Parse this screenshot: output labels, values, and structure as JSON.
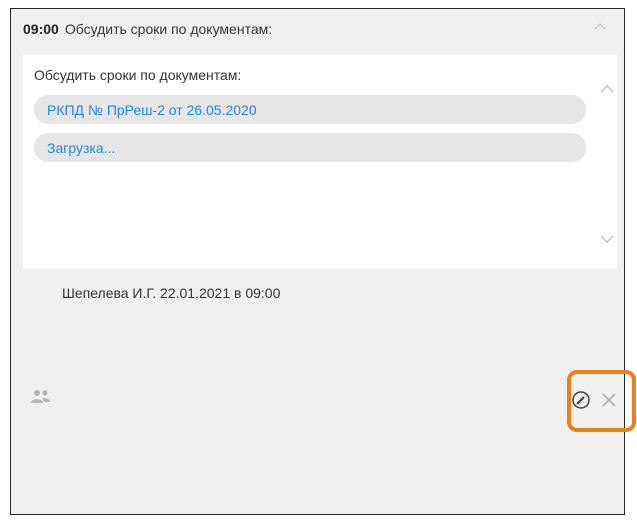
{
  "event": {
    "time": "09:00",
    "title": "Обсудить сроки по документам:"
  },
  "body": {
    "heading": "Обсудить сроки по документам:",
    "documents": [
      {
        "label": "РКПД № ПрРеш-2 от 26.05.2020"
      },
      {
        "label": "Загрузка..."
      }
    ]
  },
  "author": {
    "text": "Шепелева И.Г. 22.01.2021 в 09:00"
  },
  "icons": {
    "header_collapse": "chevron-up-icon",
    "scroll_up": "chevron-up-icon",
    "scroll_down": "chevron-down-icon",
    "participants": "people-icon",
    "edit": "pencil-circle-icon",
    "delete": "close-icon"
  },
  "colors": {
    "link": "#1e88e5",
    "highlight": "#f07f1a",
    "panel_bg": "#f0f0f0"
  }
}
